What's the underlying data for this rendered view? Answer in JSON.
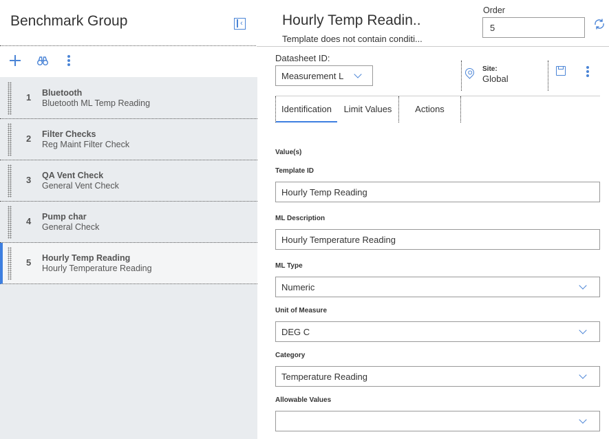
{
  "left": {
    "title": "Benchmark Group",
    "items": [
      {
        "num": "1",
        "title": "Bluetooth",
        "sub": "Bluetooth ML Temp Reading"
      },
      {
        "num": "2",
        "title": "Filter Checks",
        "sub": "Reg Maint Filter Check"
      },
      {
        "num": "3",
        "title": "QA Vent Check",
        "sub": "General Vent Check"
      },
      {
        "num": "4",
        "title": "Pump char",
        "sub": "General Check"
      },
      {
        "num": "5",
        "title": "Hourly Temp Reading",
        "sub": "Hourly Temperature Reading"
      }
    ]
  },
  "header": {
    "title": "Hourly Temp Readin..",
    "subtitle": "Template does not contain conditi...",
    "order_label": "Order",
    "order_value": "5"
  },
  "datasheet": {
    "label": "Datasheet ID:",
    "value": "Measurement Lo",
    "site_label": "Site:",
    "site_value": "Global"
  },
  "tabs": [
    "Identification",
    "Limit Values",
    "Actions"
  ],
  "form": {
    "values_label": "Value(s)",
    "template_id_label": "Template ID",
    "template_id_value": "Hourly Temp Reading",
    "ml_description_label": "ML Description",
    "ml_description_value": "Hourly Temperature Reading",
    "ml_type_label": "ML Type",
    "ml_type_value": "Numeric",
    "uom_label": "Unit of Measure",
    "uom_value": "DEG C",
    "category_label": "Category",
    "category_value": "Temperature Reading",
    "allowable_label": "Allowable Values",
    "allowable_value": ""
  },
  "colors": {
    "accent": "#3e7fe0",
    "icon": "#4a84d6",
    "panel": "#e9ecef"
  }
}
